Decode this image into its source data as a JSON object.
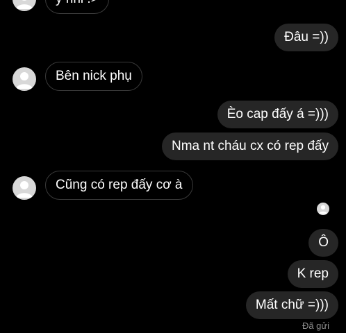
{
  "conversation": {
    "messages": [
      {
        "text": "ý nhỉ :>",
        "direction": "incoming"
      },
      {
        "text": "Đâu =))",
        "direction": "outgoing"
      },
      {
        "text": "Bên nick phụ",
        "direction": "incoming"
      },
      {
        "text": "Èo cap đấy á =)))",
        "direction": "outgoing"
      },
      {
        "text": "Nma nt cháu cx có rep đấy",
        "direction": "outgoing"
      },
      {
        "text": "Cũng có rep đấy cơ à",
        "direction": "incoming"
      },
      {
        "text": "Ô",
        "direction": "outgoing"
      },
      {
        "text": "K rep",
        "direction": "outgoing"
      },
      {
        "text": "Mất chữ =)))",
        "direction": "outgoing"
      }
    ],
    "status": "Đã gửi"
  },
  "colors": {
    "background": "#000000",
    "outgoing_bubble": "#262626",
    "incoming_border": "#3a3a3a",
    "avatar": "#d8d8d8",
    "status_text": "#8e8e8e"
  },
  "icons": {
    "avatar": "default-user-avatar-icon"
  }
}
